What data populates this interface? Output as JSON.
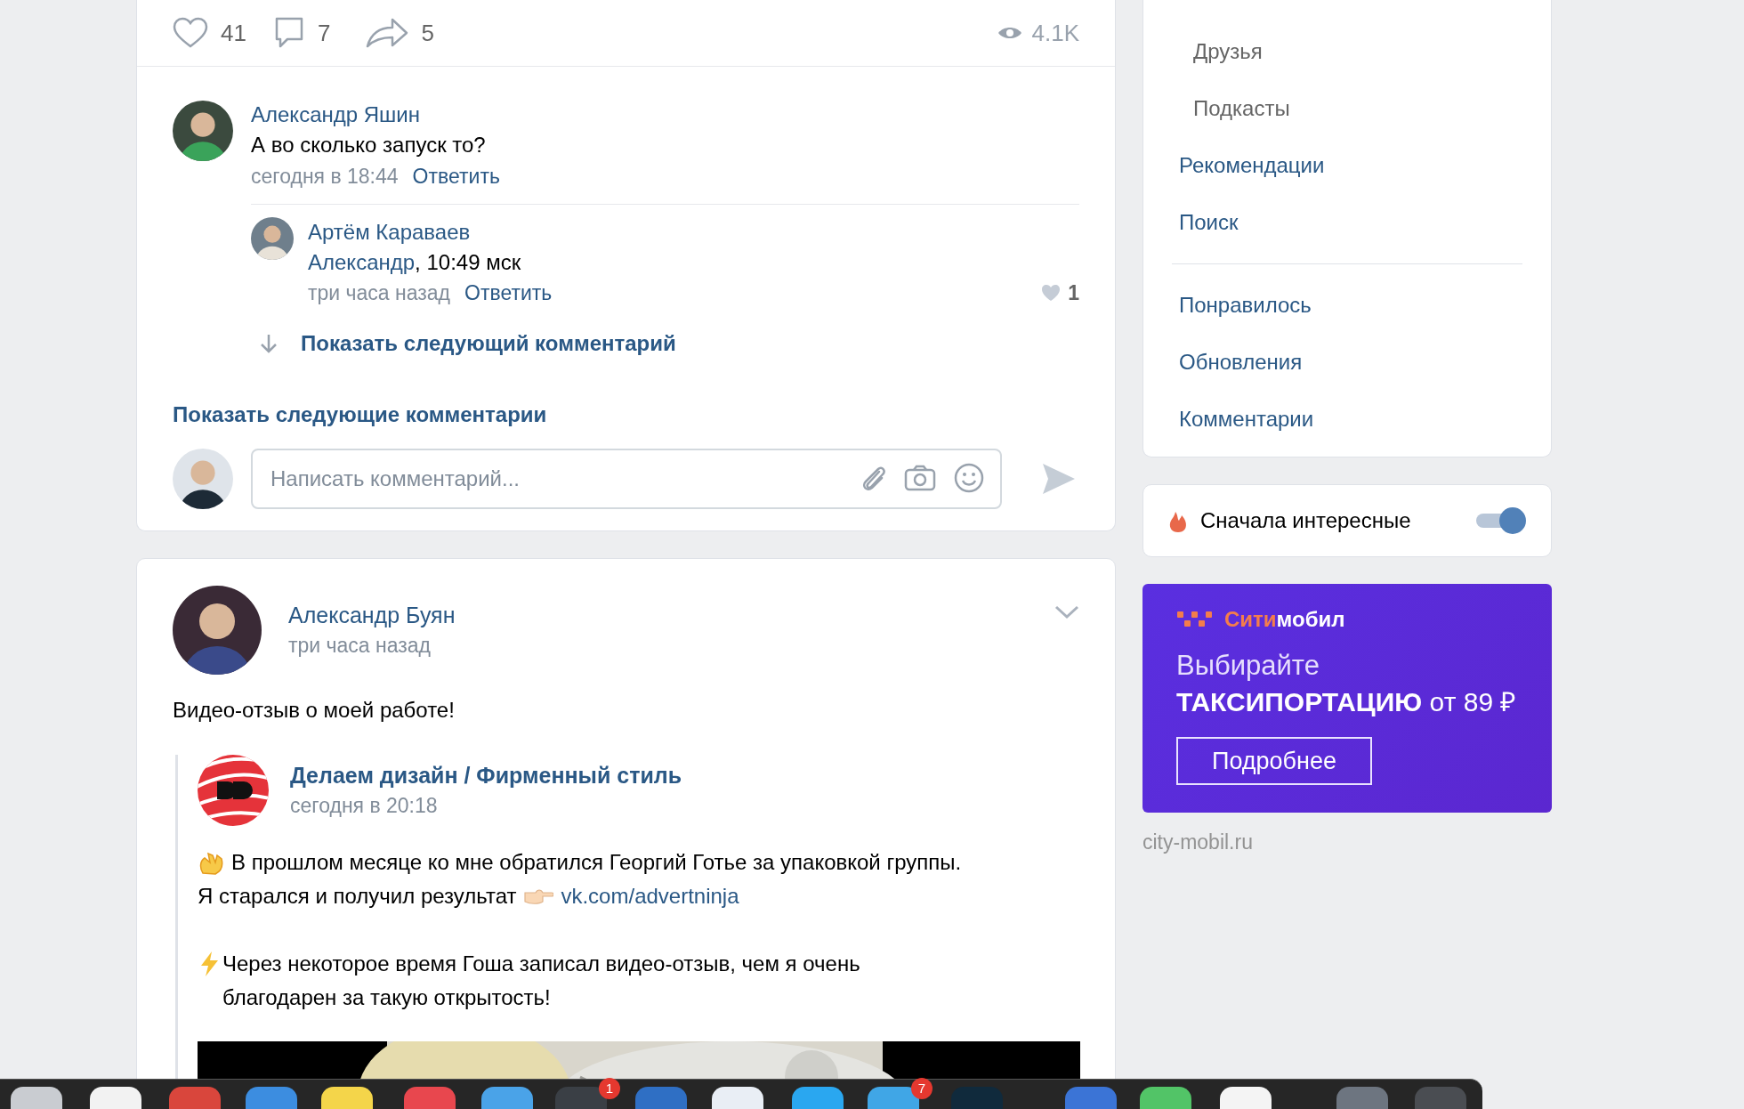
{
  "post_actions": {
    "likes": "41",
    "comments": "7",
    "shares": "5",
    "views": "4.1K"
  },
  "comments": [
    {
      "author": "Александр Яшин",
      "text": "А во сколько запуск то?",
      "time": "сегодня в 18:44",
      "reply": "Ответить",
      "replies": [
        {
          "author": "Артём Караваев",
          "addressee": "Александр",
          "text": ", 10:49 мск",
          "time": "три часа назад",
          "reply": "Ответить",
          "likes": "1"
        }
      ],
      "show_next": "Показать следующий комментарий"
    }
  ],
  "show_more": "Показать следующие комментарии",
  "comment_field": {
    "placeholder": "Написать комментарий..."
  },
  "post": {
    "author": "Александр Буян",
    "time": "три часа назад",
    "text": "Видео-отзыв о моей работе!",
    "repost": {
      "author": "Делаем дизайн / Фирменный стиль",
      "time": "сегодня в 20:18",
      "paragraph_1": "В прошлом месяце ко мне обратился Георгий Готье за упаковкой группы.",
      "paragraph_1_end": "Я старался и получил результат",
      "link": "vk.com/advertninja",
      "paragraph_2": "Через некоторое время Гоша записал видео-отзыв, чем я очень\nблагодарен за такую открытость!"
    }
  },
  "menu": [
    {
      "label": "Друзья",
      "kind": "subitem"
    },
    {
      "label": "Подкасты",
      "kind": "subitem"
    },
    {
      "label": "Рекомендации",
      "kind": "item"
    },
    {
      "label": "Поиск",
      "kind": "item"
    },
    {
      "kind": "divider"
    },
    {
      "label": "Понравилось",
      "kind": "item"
    },
    {
      "label": "Обновления",
      "kind": "item"
    },
    {
      "label": "Комментарии",
      "kind": "item"
    }
  ],
  "sort_toggle": {
    "label": "Сначала интересные",
    "on": true
  },
  "ad": {
    "brand_first": "Сити",
    "brand_second": "мобил",
    "title": "Выбирайте",
    "headline": "**ТАКСИПОРТАЦИЮ** от 89 ₽",
    "button": "Подробнее",
    "domain": "city-mobil.ru"
  },
  "dock_badges": [
    "1",
    "7"
  ]
}
